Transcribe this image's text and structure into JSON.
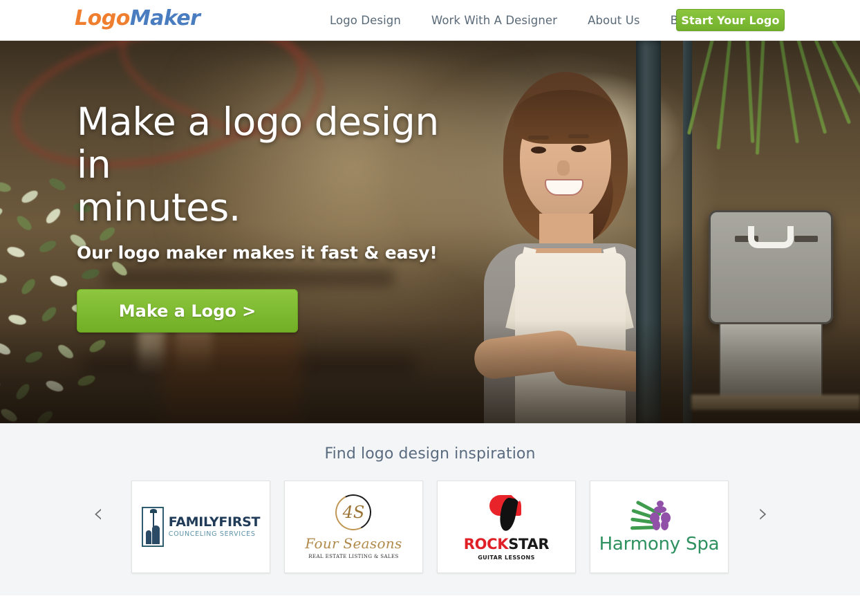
{
  "header": {
    "brand": {
      "part1": "Logo",
      "part2": "Maker",
      "color1": "#ef7f2e",
      "color2": "#4a7cc0"
    },
    "nav": [
      {
        "label": "Logo Design",
        "name": "nav-logo-design"
      },
      {
        "label": "Work With A Designer",
        "name": "nav-work-with-a-designer"
      },
      {
        "label": "About Us",
        "name": "nav-about-us"
      },
      {
        "label": "Blog",
        "name": "nav-blog"
      }
    ],
    "cta": {
      "label": "Start Your Logo",
      "color": "#7fbb32"
    }
  },
  "hero": {
    "title_line1": "Make a logo design in",
    "title_line2": "minutes.",
    "subtitle": "Our logo maker makes it fast & easy!",
    "button_label": "Make a Logo >",
    "button_color": "#7fbb32",
    "image_description": "Smiling woman in apron standing in shop doorway"
  },
  "inspiration": {
    "title": "Find logo design inspiration",
    "background": "#f4f5f6",
    "prev_arrow": "‹",
    "next_arrow": "›",
    "cards": [
      {
        "name": "FAMILYFIRST",
        "tagline": "COUNCELING SERVICES",
        "colors": {
          "name": "#1f3b57",
          "tagline": "#5d93a8"
        }
      },
      {
        "name": "Four Seasons",
        "tagline": "REAL ESTATE LISTING & SALES",
        "monogram": "4S",
        "colors": {
          "name": "#b08a4b",
          "tagline": "#2b2b2b"
        }
      },
      {
        "name_part1": "ROCK",
        "name_part2": "STAR",
        "tagline": "GUITAR LESSONS",
        "colors": {
          "part1": "#e02027",
          "part2": "#1a1a1a"
        }
      },
      {
        "name": "Harmony Spa",
        "tagline": "",
        "colors": {
          "name": "#2f9160",
          "accent": "#9151a8"
        }
      }
    ]
  }
}
